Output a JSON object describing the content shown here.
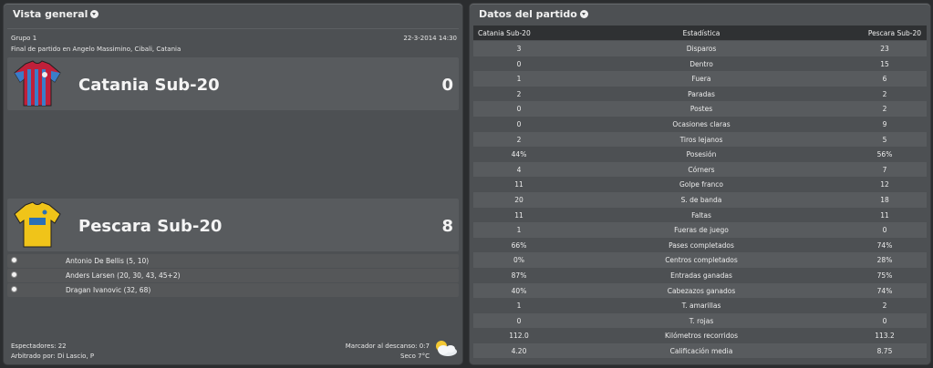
{
  "overview": {
    "title": "Vista general",
    "group": "Grupo 1",
    "date": "22-3-2014 14:30",
    "venue": "Final de partido en Angelo Massimino, Cibali, Catania",
    "home": {
      "name": "Catania Sub-20",
      "score": "0",
      "kit_colors": [
        "#3a7dc9",
        "#c0203a"
      ]
    },
    "away": {
      "name": "Pescara Sub-20",
      "score": "8",
      "kit_colors": [
        "#f0c419",
        "#2a6fb5"
      ]
    },
    "scorers": [
      {
        "name": "Antonio De Bellis (5, 10)",
        "icon": "ball-icon"
      },
      {
        "name": "Anders Larsen (20, 30, 43, 45+2)",
        "icon": "ball-icon"
      },
      {
        "name": "Dragan Ivanovic (32, 68)",
        "icon": "ball-icon"
      }
    ],
    "spectators": "Espectadores: 22",
    "referee": "Arbitrado por: Di Lascio, P",
    "halftime": "Marcador al descanso: 0:7",
    "weather": "Seco 7°C",
    "weather_icon": "partly-cloudy-icon"
  },
  "stats": {
    "title": "Datos del partido",
    "header": {
      "home": "Catania Sub-20",
      "label": "Estadística",
      "away": "Pescara Sub-20"
    },
    "rows": [
      {
        "home": "3",
        "label": "Disparos",
        "away": "23"
      },
      {
        "home": "0",
        "label": "Dentro",
        "away": "15"
      },
      {
        "home": "1",
        "label": "Fuera",
        "away": "6"
      },
      {
        "home": "2",
        "label": "Paradas",
        "away": "2"
      },
      {
        "home": "0",
        "label": "Postes",
        "away": "2"
      },
      {
        "home": "0",
        "label": "Ocasiones claras",
        "away": "9"
      },
      {
        "home": "2",
        "label": "Tiros lejanos",
        "away": "5"
      },
      {
        "home": "44%",
        "label": "Posesión",
        "away": "56%"
      },
      {
        "home": "4",
        "label": "Córners",
        "away": "7"
      },
      {
        "home": "11",
        "label": "Golpe franco",
        "away": "12"
      },
      {
        "home": "20",
        "label": "S. de banda",
        "away": "18"
      },
      {
        "home": "11",
        "label": "Faltas",
        "away": "11"
      },
      {
        "home": "1",
        "label": "Fueras de juego",
        "away": "0"
      },
      {
        "home": "66%",
        "label": "Pases completados",
        "away": "74%"
      },
      {
        "home": "0%",
        "label": "Centros completados",
        "away": "28%"
      },
      {
        "home": "87%",
        "label": "Entradas ganadas",
        "away": "75%"
      },
      {
        "home": "40%",
        "label": "Cabezazos ganados",
        "away": "74%"
      },
      {
        "home": "1",
        "label": "T. amarillas",
        "away": "2"
      },
      {
        "home": "0",
        "label": "T. rojas",
        "away": "0"
      },
      {
        "home": "112.0",
        "label": "Kilómetros recorridos",
        "away": "113.2"
      },
      {
        "home": "4.20",
        "label": "Calificación media",
        "away": "8.75"
      }
    ]
  }
}
